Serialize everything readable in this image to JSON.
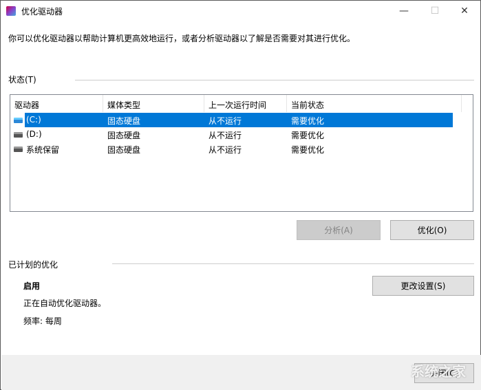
{
  "window": {
    "title": "优化驱动器",
    "minimize": "—",
    "maximize": "☐",
    "close": "✕"
  },
  "description": "你可以优化驱动器以帮助计算机更高效地运行，或者分析驱动器以了解是否需要对其进行优化。",
  "status_section": {
    "label": "状态(T)"
  },
  "table": {
    "columns": [
      "驱动器",
      "媒体类型",
      "上一次运行时间",
      "当前状态"
    ],
    "rows": [
      {
        "drive": "(C:)",
        "media": "固态硬盘",
        "last_run": "从不运行",
        "status": "需要优化",
        "selected": true
      },
      {
        "drive": "(D:)",
        "media": "固态硬盘",
        "last_run": "从不运行",
        "status": "需要优化"
      },
      {
        "drive": "系统保留",
        "media": "固态硬盘",
        "last_run": "从不运行",
        "status": "需要优化"
      }
    ]
  },
  "buttons": {
    "analyze": "分析(A)",
    "optimize": "优化(O)",
    "change_settings": "更改设置(S)",
    "close": "关闭(C)"
  },
  "scheduled": {
    "label": "已计划的优化",
    "state": "启用",
    "detail": "正在自动优化驱动器。",
    "frequency": "频率: 每周"
  },
  "watermark": "系统之家"
}
